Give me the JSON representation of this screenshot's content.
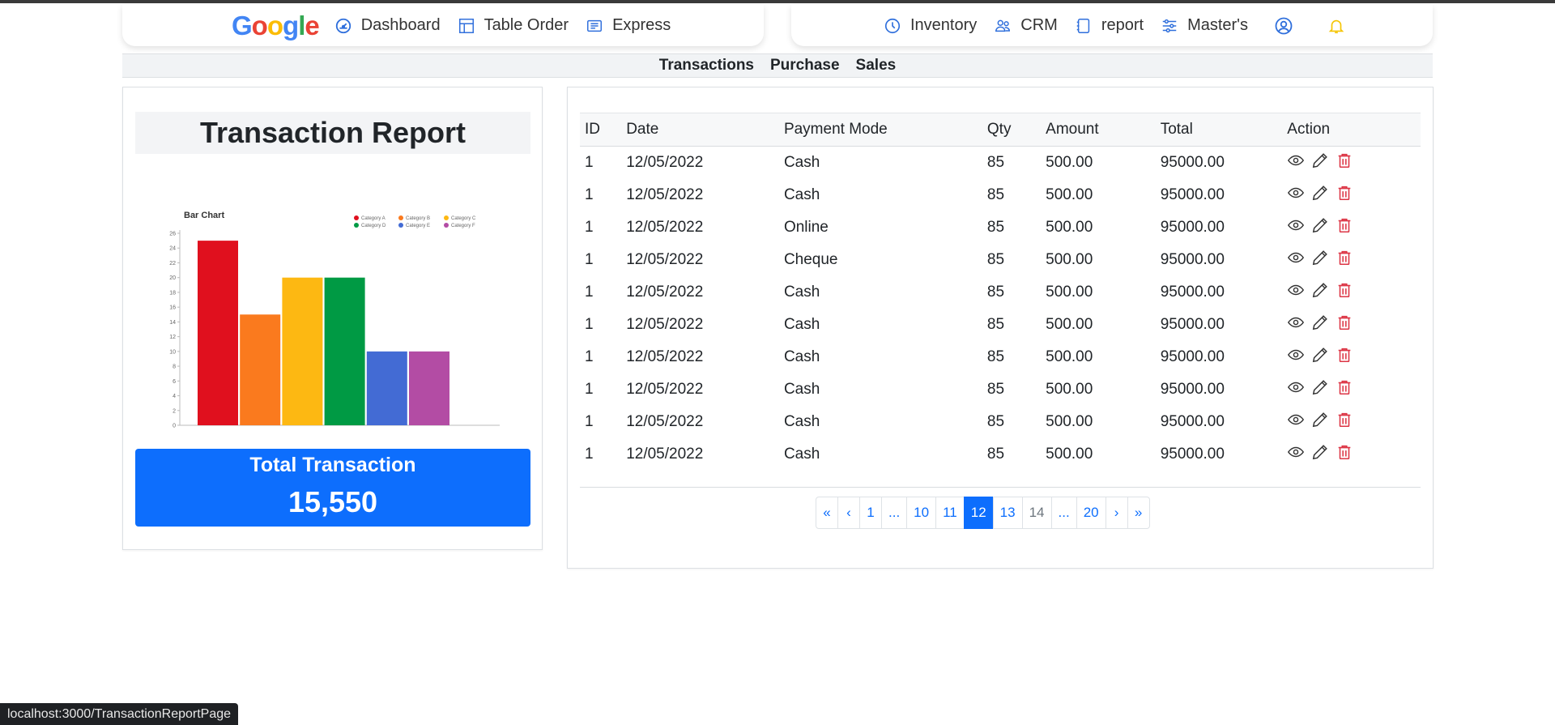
{
  "nav_left": {
    "brand": {
      "letters": [
        "G",
        "o",
        "o",
        "g",
        "l",
        "e"
      ],
      "colors": [
        "#4285F4",
        "#EA4335",
        "#FBBC05",
        "#4285F4",
        "#34A853",
        "#EA4335"
      ]
    },
    "items": [
      {
        "label": "Dashboard",
        "icon": "speedometer-icon"
      },
      {
        "label": "Table Order",
        "icon": "table-grid-icon"
      },
      {
        "label": "Express",
        "icon": "list-card-icon"
      }
    ]
  },
  "nav_right": {
    "items": [
      {
        "label": "Inventory",
        "icon": "clock-icon"
      },
      {
        "label": "CRM",
        "icon": "people-icon"
      },
      {
        "label": "report",
        "icon": "notebook-icon"
      },
      {
        "label": "Master's",
        "icon": "sliders-icon"
      }
    ]
  },
  "subnav": [
    "Transactions",
    "Purchase",
    "Sales"
  ],
  "report": {
    "title": "Transaction Report",
    "total_label": "Total Transaction",
    "total_value": "15,550"
  },
  "chart_data": {
    "type": "bar",
    "title": "Bar Chart",
    "categories": [
      "Category A",
      "Category B",
      "Category C",
      "Category D",
      "Category E",
      "Category F"
    ],
    "values": [
      25,
      15,
      20,
      20,
      10,
      10
    ],
    "colors": [
      "#E0101E",
      "#FA7A1E",
      "#FDB812",
      "#009A44",
      "#436BD4",
      "#B34CA4"
    ],
    "yticks": [
      0,
      2,
      4,
      6,
      8,
      10,
      12,
      14,
      16,
      18,
      20,
      22,
      24,
      26
    ],
    "ylim": [
      0,
      26
    ],
    "legend_position": "top-right",
    "xlabel": "",
    "ylabel": ""
  },
  "table": {
    "columns": [
      "ID",
      "Date",
      "Payment Mode",
      "Qty",
      "Amount",
      "Total",
      "Action"
    ],
    "rows": [
      [
        "1",
        "12/05/2022",
        "Cash",
        "85",
        "500.00",
        "95000.00"
      ],
      [
        "1",
        "12/05/2022",
        "Cash",
        "85",
        "500.00",
        "95000.00"
      ],
      [
        "1",
        "12/05/2022",
        "Online",
        "85",
        "500.00",
        "95000.00"
      ],
      [
        "1",
        "12/05/2022",
        "Cheque",
        "85",
        "500.00",
        "95000.00"
      ],
      [
        "1",
        "12/05/2022",
        "Cash",
        "85",
        "500.00",
        "95000.00"
      ],
      [
        "1",
        "12/05/2022",
        "Cash",
        "85",
        "500.00",
        "95000.00"
      ],
      [
        "1",
        "12/05/2022",
        "Cash",
        "85",
        "500.00",
        "95000.00"
      ],
      [
        "1",
        "12/05/2022",
        "Cash",
        "85",
        "500.00",
        "95000.00"
      ],
      [
        "1",
        "12/05/2022",
        "Cash",
        "85",
        "500.00",
        "95000.00"
      ],
      [
        "1",
        "12/05/2022",
        "Cash",
        "85",
        "500.00",
        "95000.00"
      ]
    ]
  },
  "pagination": {
    "items": [
      "«",
      "‹",
      "1",
      "...",
      "10",
      "11",
      "12",
      "13",
      "14",
      "...",
      "20",
      "›",
      "»"
    ],
    "active": "12"
  },
  "status_url": "localhost:3000/TransactionReportPage",
  "colors": {
    "accent": "#0d6efd",
    "delete": "#dc3545",
    "nav_icon": "#2f6fdc",
    "bell": "#f5c400"
  }
}
